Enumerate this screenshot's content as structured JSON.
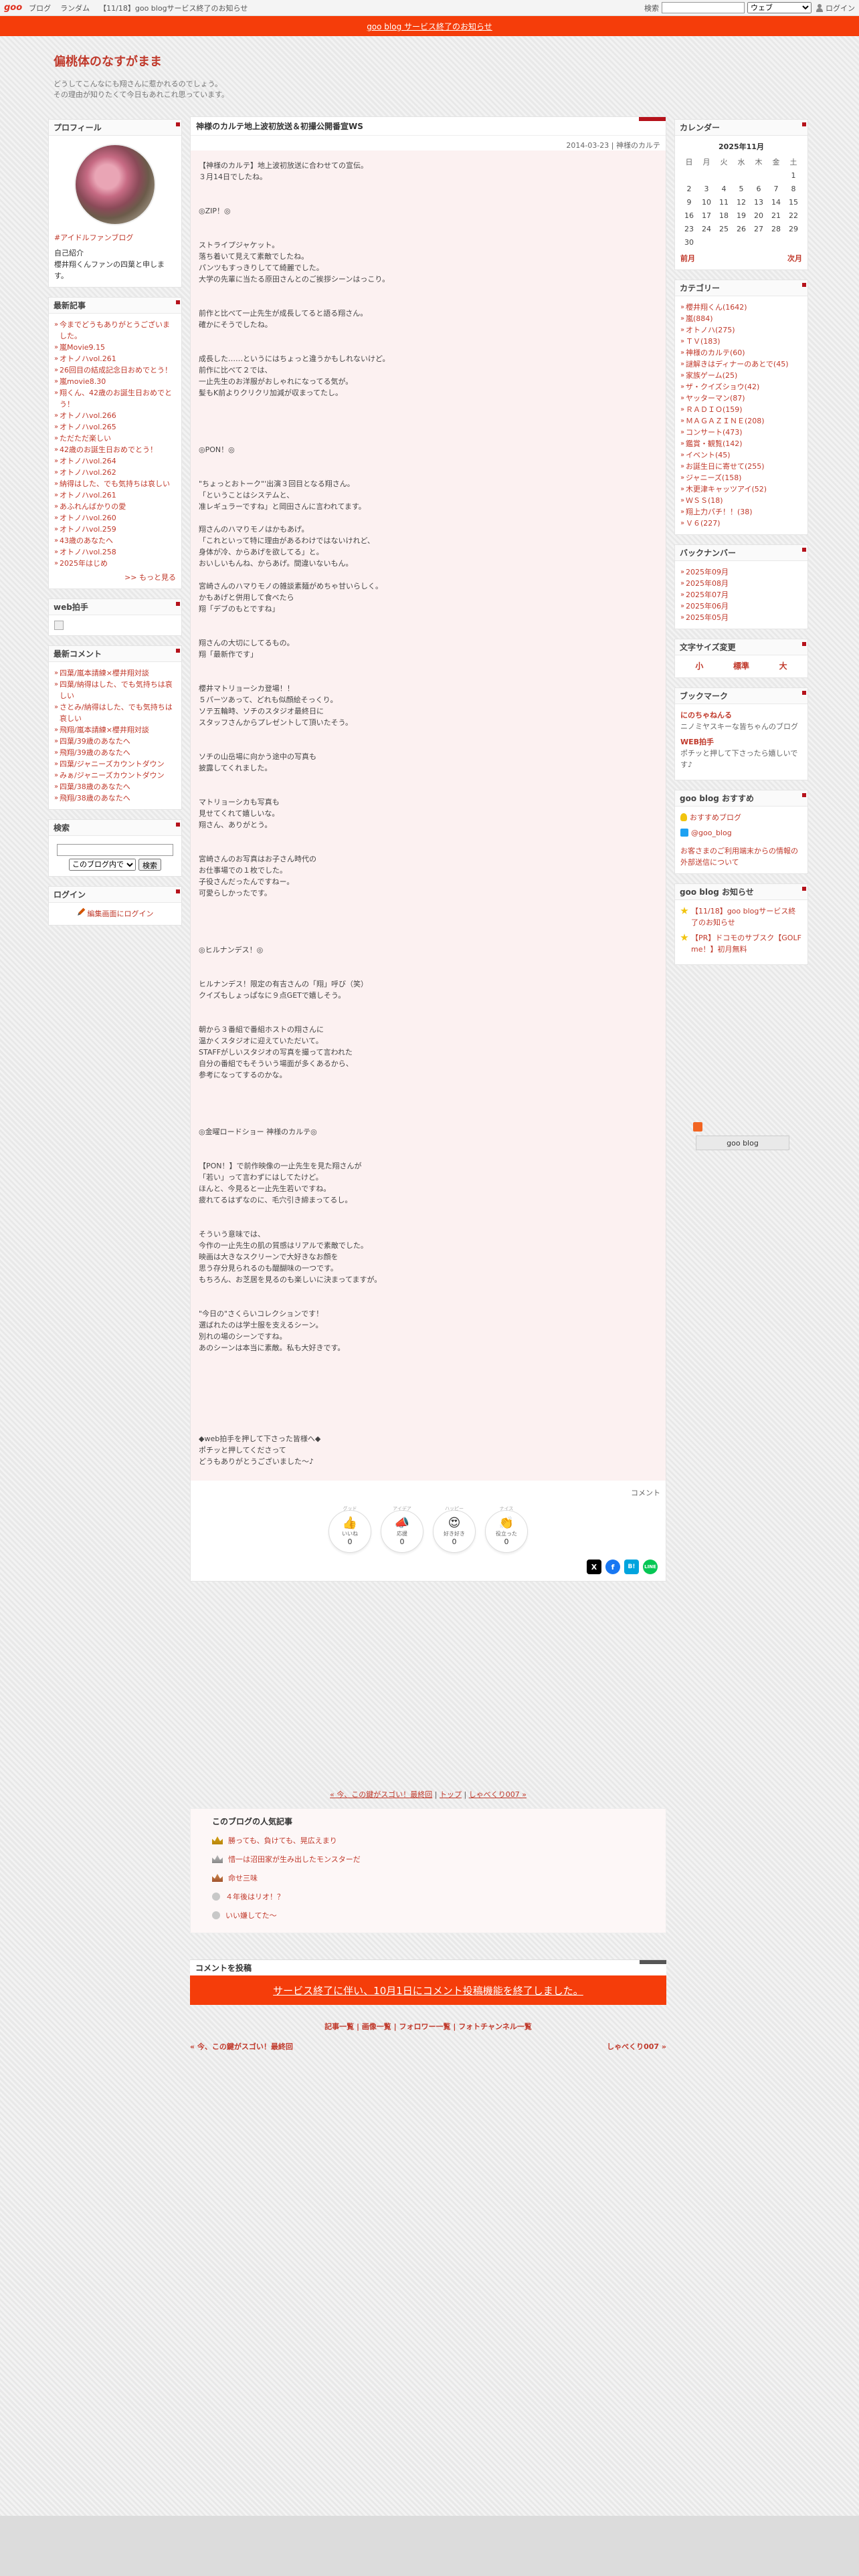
{
  "topbar": {
    "logo": "goo",
    "links": [
      "ブログ",
      "ランダム",
      "【11/18】goo blogサービス終了のお知らせ"
    ],
    "search_label": "検索",
    "search_scope": "ウェブ",
    "login": "ログイン"
  },
  "notice": {
    "text": "goo blog サービス終了のお知らせ"
  },
  "header": {
    "title": "偏桃体のなすがまま",
    "desc_line1": "どうしてこんなにも翔さんに惹かれるのでしょう。",
    "desc_line2": "その理由が知りたくて今日もあれこれ思っています。"
  },
  "profile": {
    "title": "プロフィール",
    "fan_link": "#アイドルファンブログ",
    "intro_label": "自己紹介",
    "intro_text": "櫻井翔くんファンの四葉と申します。"
  },
  "recent_posts": {
    "title": "最新記事",
    "items": [
      "今までどうもありがとうございました。",
      "嵐Movie9.15",
      "オトノハvol.261",
      "26回目の結成記念日おめでとう！",
      "嵐movie8.30",
      "翔くん、42歳のお誕生日おめでとう！",
      "オトノハvol.266",
      "オトノハvol.265",
      "ただただ楽しい",
      "42歳のお誕生日おめでとう！",
      "オトノハvol.264",
      "オトノハvol.262",
      "納得はした、でも気持ちは哀しい",
      "オトノハvol.261",
      "あふれんばかりの愛",
      "オトノハvol.260",
      "オトノハvol.259",
      "43歳のあなたへ",
      "オトノハvol.258",
      "2025年はじめ"
    ],
    "more": ">> もっと見る"
  },
  "web_clap": {
    "title": "web拍手"
  },
  "recent_comments": {
    "title": "最新コメント",
    "items": [
      "四葉/嵐本請練×櫻井翔対談",
      "四葉/納得はした、でも気持ちは哀しい",
      "さとみ/納得はした、でも気持ちは哀しい",
      "飛翔/嵐本請練×櫻井翔対談",
      "四葉/39歳のあなたへ",
      "飛翔/39歳のあなたへ",
      "四葉/ジャニーズカウントダウン",
      "みぁ/ジャニーズカウントダウン",
      "四葉/38歳のあなたへ",
      "飛翔/38歳のあなたへ"
    ]
  },
  "search": {
    "title": "検索",
    "scope": "このブログ内で",
    "button": "検索"
  },
  "login_widget": {
    "title": "ログイン",
    "link": "編集画面にログイン"
  },
  "article": {
    "title": "神様のカルテ地上波初放送＆初撮公開番宣WS",
    "meta": "2014-03-23 | 神様のカルテ",
    "body": "【神様のカルテ】地上波初放送に合わせての宣伝。\n３月14日でしたね。\n\n\n◎ZIP！◎\n\n\nストライプジャケット。\n落ち着いて見えて素敵でしたね。\nパンツもすっきりしてて綺麗でした。\n大学の先輩に当たる原田さんとのご挨拶シーンはっこり。\n\n\n前作と比べて一止先生が成長してると語る翔さん。\n確かにそうでしたね。\n\n\n成長した……というにはちょっと違うかもしれないけど。\n前作に比べて２では、\n一止先生のお洋服がおしゃれになってる気が。\n髪もK前よりクリクリ加減が収まってたし。\n\n\n\n\n◎PON！◎\n\n\n\"ちょっとおトーク\"'出演３回目となる翔さん。\n「ということはシステムと、\n准レギュラーですね」と岡田さんに言われてます。\n\n翔さんのハマりモノはかもあげ。\n「これといって特に理由があるわけではないけれど、\n身体が冷、からあげを欲してる」と。\nおいしいもんね、からあげ。間違いないもん。\n\n宮崎さんのハマりモノの雑談素麺がめちゃ甘いらしく。\nかもあげと併用して食べたら\n翔「デブのもとですね」\n\n\n翔さんの大切にしてるもの。\n翔「最新作です」\n\n\n櫻井マトリョーシカ登場！！\n５パーツあって、どれも似顔絵そっくり。\nソテ五輪時、ソチのスタジオ最終日に\nスタッフさんからプレゼントして頂いたそう。\n\n\nソチの山岳場に向かう途中の写真も\n披露してくれました。\n\n\nマトリョーシカも写真も\n見せてくれて嬉しいな。\n翔さん、ありがとう。\n\n\n宮崎さんのお写真はお子さん時代の\nお仕事場での１枚でした。\n子役さんだったんですねー。\n可愛らしかったです。\n\n\n\n\n◎ヒルナンデス！◎\n\n\nヒルナンデス！限定の有吉さんの「翔」呼び（笑）\nクイズもしょっぱなに９点GETで嬉しそう。\n\n\n朝から３番組で番組ホストの翔さんに\n温かくスタジオに迎えていただいて。\nSTAFFがしいスタジオの写真を撮って言われた\n自分の番組でもそういう場面が多くあるから、\n参考になってするのかな。\n\n\n\n\n◎金曜ロードショー 神様のカルテ◎\n\n\n【PON！】で前作映像の一止先生を見た翔さんが\n「若い」って言わずにはしてたけど。\nほんと、今見ると一止先生若いですね。\n疲れてるはずなのに、毛穴引き締まってるし。\n\n\nそういう意味では、\n今作の一止先生の肌の質感はリアルで素敵でした。\n映画は大きなスクリーンで大好きなお顔を\n思う存分見られるのも醍醐味の一つです。\nもちろん、お芝居を見るのも楽しいに決まってますが。\n\n\n\"今日の\"さくらいコレクションです！\n選ばれたのは学士服を支えるシーン。\n別れの場のシーンですね。\nあのシーンは本当に素敵。私も大好きです。\n\n\n\n\n\n\n\n◆web拍手を押して下さった皆様へ◆\nポチッと押してくださって\nどうもありがとうございました〜♪"
  },
  "comment_label": "コメント",
  "reactions": [
    {
      "top": "グッド",
      "emoji": "👍",
      "label": "いいね",
      "count": "0"
    },
    {
      "top": "アイデア",
      "emoji": "📣",
      "label": "応援",
      "count": "0"
    },
    {
      "top": "ハッピー",
      "emoji": "😍",
      "label": "好き好き",
      "count": "0"
    },
    {
      "top": "ナイス",
      "emoji": "👏",
      "label": "役立った",
      "count": "0"
    }
  ],
  "share": [
    "X",
    "f",
    "B!",
    "LINE"
  ],
  "pager": {
    "prev": "« 今、この鍵がスゴい！最終回",
    "top": "トップ",
    "next": "しゃべくり007 »"
  },
  "popular": {
    "title": "このブログの人気記事",
    "items": [
      "勝っても、負けても、晃広えまり",
      "惜一は沼田家が生み出したモンスターだ",
      "命せ三味",
      "４年後はリオ！？",
      "いい嫌してた〜"
    ]
  },
  "comment_post": {
    "title": "コメントを投稿",
    "closed": "サービス終了に伴い、10月1日にコメント投稿機能を終了しました。"
  },
  "footer_links": [
    "記事一覧",
    "画像一覧",
    "フォロワー一覧",
    "フォトチャンネル一覧"
  ],
  "footer_nav": {
    "prev": "« 今、この鍵がスゴい！最終回",
    "next": "しゃべくり007 »"
  },
  "calendar": {
    "title": "カレンダー",
    "month": "2025年11月",
    "weekdays": [
      "日",
      "月",
      "火",
      "水",
      "木",
      "金",
      "土"
    ],
    "weeks": [
      [
        "",
        "",
        "",
        "",
        "",
        "",
        "1"
      ],
      [
        "2",
        "3",
        "4",
        "5",
        "6",
        "7",
        "8"
      ],
      [
        "9",
        "10",
        "11",
        "12",
        "13",
        "14",
        "15"
      ],
      [
        "16",
        "17",
        "18",
        "19",
        "20",
        "21",
        "22"
      ],
      [
        "23",
        "24",
        "25",
        "26",
        "27",
        "28",
        "29"
      ],
      [
        "30",
        "",
        "",
        "",
        "",
        "",
        ""
      ]
    ],
    "prev": "前月",
    "next": "次月"
  },
  "categories": {
    "title": "カテゴリー",
    "items": [
      "櫻井翔くん(1642)",
      "嵐(884)",
      "オトノハ(275)",
      "ＴＶ(183)",
      "神様のカルテ(60)",
      "謎解きはディナーのあとで(45)",
      "家族ゲーム(25)",
      "ザ・クイズショウ(42)",
      "ヤッターマン(87)",
      "ＲＡＤＩＯ(159)",
      "ＭＡＧＡＺＩＮＥ(208)",
      "コンサート(473)",
      "鑑賞・観覧(142)",
      "イベント(45)",
      "お誕生日に寄せて(255)",
      "ジャニーズ(158)",
      "木更津キャッツアイ(52)",
      "ＷＳＳ(18)",
      "翔上力パチ！！(38)",
      "Ｖ６(227)"
    ]
  },
  "backnumber": {
    "title": "バックナンバー",
    "items": [
      "2025年09月",
      "2025年08月",
      "2025年07月",
      "2025年06月",
      "2025年05月"
    ]
  },
  "fontsize": {
    "title": "文字サイズ変更",
    "small": "小",
    "normal": "標準",
    "large": "大"
  },
  "bookmark": {
    "title": "ブックマーク",
    "items": [
      {
        "name": "にのちゃねんる",
        "desc": "ニノミヤスキーな皆ちゃんのブログ"
      },
      {
        "name": "WEB拍手",
        "desc": "ポチッと押して下さったら嬉しいです♪"
      }
    ]
  },
  "goo_recommend": {
    "title": "goo blog おすすめ",
    "item1": "おすすめブログ",
    "item2": "@goo_blog",
    "item3": "お客さまのご利用端末からの情報の外部送信について"
  },
  "goo_notice": {
    "title": "goo blog お知らせ",
    "items": [
      "【11/18】goo blogサービス終了のお知らせ",
      "【PR】ドコモのサブスク【GOLF me！】初月無料"
    ]
  },
  "goo_badge": "goo blog",
  "colors": {
    "accent": "#c0392b",
    "notice": "#f53d0a",
    "marker": "#b5121b"
  }
}
